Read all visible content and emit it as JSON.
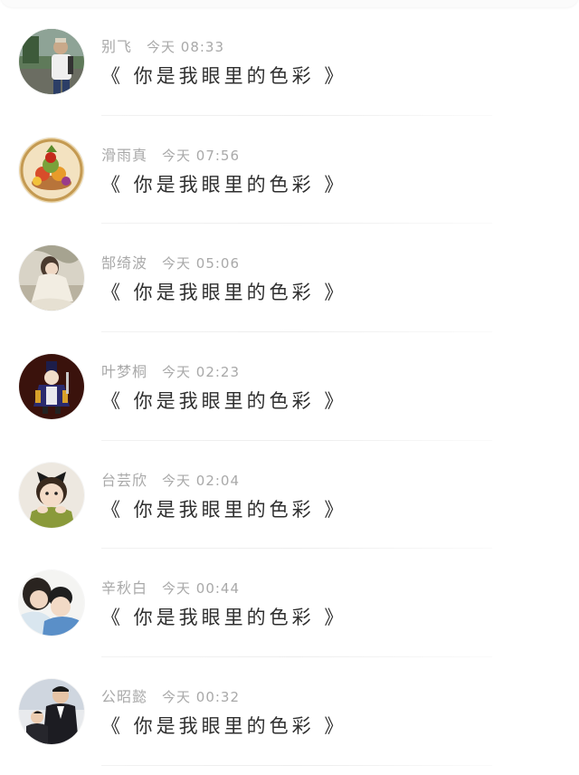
{
  "comments": [
    {
      "name": "别飞",
      "time": "今天 08:33",
      "message": "《 你是我眼里的色彩 》",
      "avatar_icon": "avatar-man-photo-icon"
    },
    {
      "name": "滑雨真",
      "time": "今天 07:56",
      "message": "《 你是我眼里的色彩 》",
      "avatar_icon": "avatar-fruit-platter-icon"
    },
    {
      "name": "郜绮波",
      "time": "今天 05:06",
      "message": "《 你是我眼里的色彩 》",
      "avatar_icon": "avatar-woman-painting-icon"
    },
    {
      "name": "叶梦桐",
      "time": "今天 02:23",
      "message": "《 你是我眼里的色彩 》",
      "avatar_icon": "avatar-cartoon-character-icon"
    },
    {
      "name": "台芸欣",
      "time": "今天 02:04",
      "message": "《 你是我眼里的色彩 》",
      "avatar_icon": "avatar-girl-bow-icon"
    },
    {
      "name": "辛秋白",
      "time": "今天 00:44",
      "message": "《 你是我眼里的色彩 》",
      "avatar_icon": "avatar-mother-child-icon"
    },
    {
      "name": "公昭懿",
      "time": "今天 00:32",
      "message": "《 你是我眼里的色彩 》",
      "avatar_icon": "avatar-father-son-icon"
    }
  ]
}
